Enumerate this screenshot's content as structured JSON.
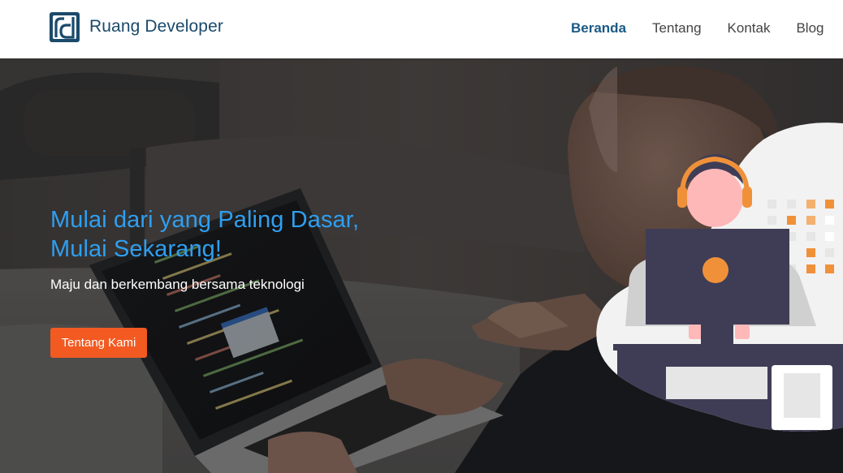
{
  "brand": {
    "logo_icon": "rd-logo-icon",
    "name": "Ruang Developer",
    "color": "#1a4a6b"
  },
  "nav": {
    "items": [
      {
        "label": "Beranda",
        "active": true
      },
      {
        "label": "Tentang",
        "active": false
      },
      {
        "label": "Kontak",
        "active": false
      },
      {
        "label": "Blog",
        "active": false
      }
    ],
    "active_color": "#1a5a85"
  },
  "hero": {
    "title_line1": "Mulai dari yang Paling Dasar,",
    "title_line2": "Mulai Sekarang!",
    "subtitle": "Maju dan berkembang bersama teknologi",
    "button_label": "Tentang Kami",
    "title_color": "#2f9ff0",
    "button_color": "#f25a22",
    "background_image": "developer-typing-on-laptop-photo",
    "illustration": "developer-with-headset-at-computer-illustration"
  }
}
